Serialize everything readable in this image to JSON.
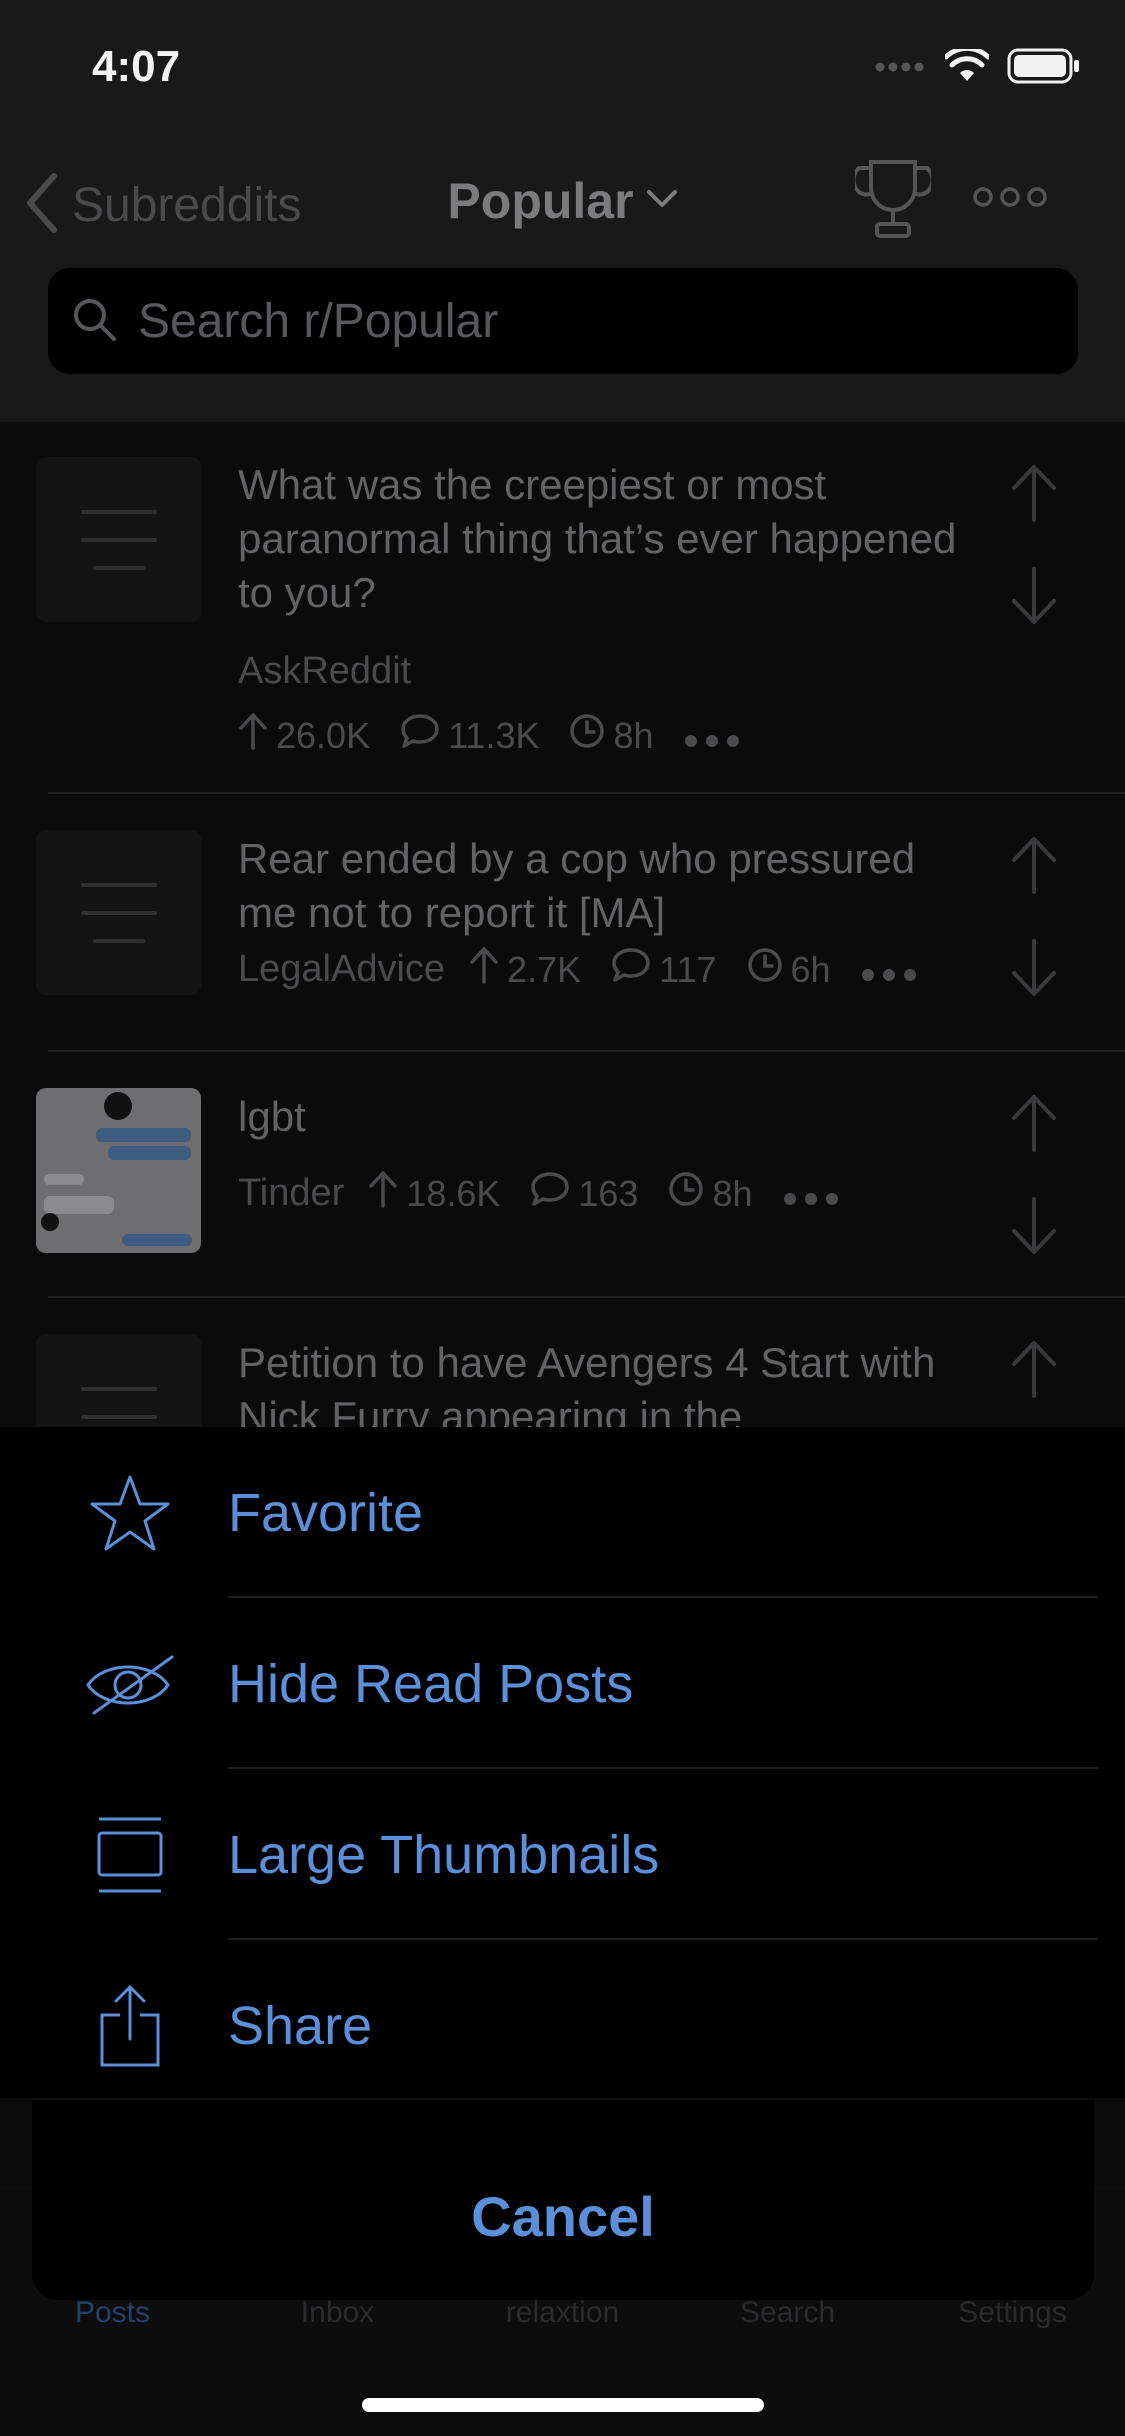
{
  "status_bar": {
    "time": "4:07"
  },
  "nav": {
    "back_label": "Subreddits",
    "title": "Popular",
    "search_placeholder": "Search r/Popular"
  },
  "posts": [
    {
      "title": "What was the creepiest or most paranormal thing that’s ever happened to you?",
      "subreddit": "AskReddit",
      "score": "26.0K",
      "comments": "11.3K",
      "age": "8h"
    },
    {
      "title": "Rear ended by a cop who pressured me not to report it [MA]",
      "subreddit": "LegalAdvice",
      "score": "2.7K",
      "comments": "117",
      "age": "6h"
    },
    {
      "title": "lgbt",
      "subreddit": "Tinder",
      "score": "18.6K",
      "comments": "163",
      "age": "8h"
    },
    {
      "title": "Petition to have Avengers 4 Start with Nick Furry appearing in the"
    }
  ],
  "action_sheet": {
    "items": [
      {
        "label": "Favorite",
        "icon": "star-icon"
      },
      {
        "label": "Hide Read Posts",
        "icon": "eye-slash-icon"
      },
      {
        "label": "Large Thumbnails",
        "icon": "thumbnail-icon"
      },
      {
        "label": "Share",
        "icon": "share-icon"
      }
    ],
    "cancel": "Cancel"
  },
  "tabs": [
    {
      "label": "Posts",
      "active": true
    },
    {
      "label": "Inbox"
    },
    {
      "label": "relaxtion"
    },
    {
      "label": "Search"
    },
    {
      "label": "Settings"
    }
  ],
  "colors": {
    "accent": "#5b8fd9",
    "sheet_bg": "#000000",
    "dim_text": "#636366"
  }
}
